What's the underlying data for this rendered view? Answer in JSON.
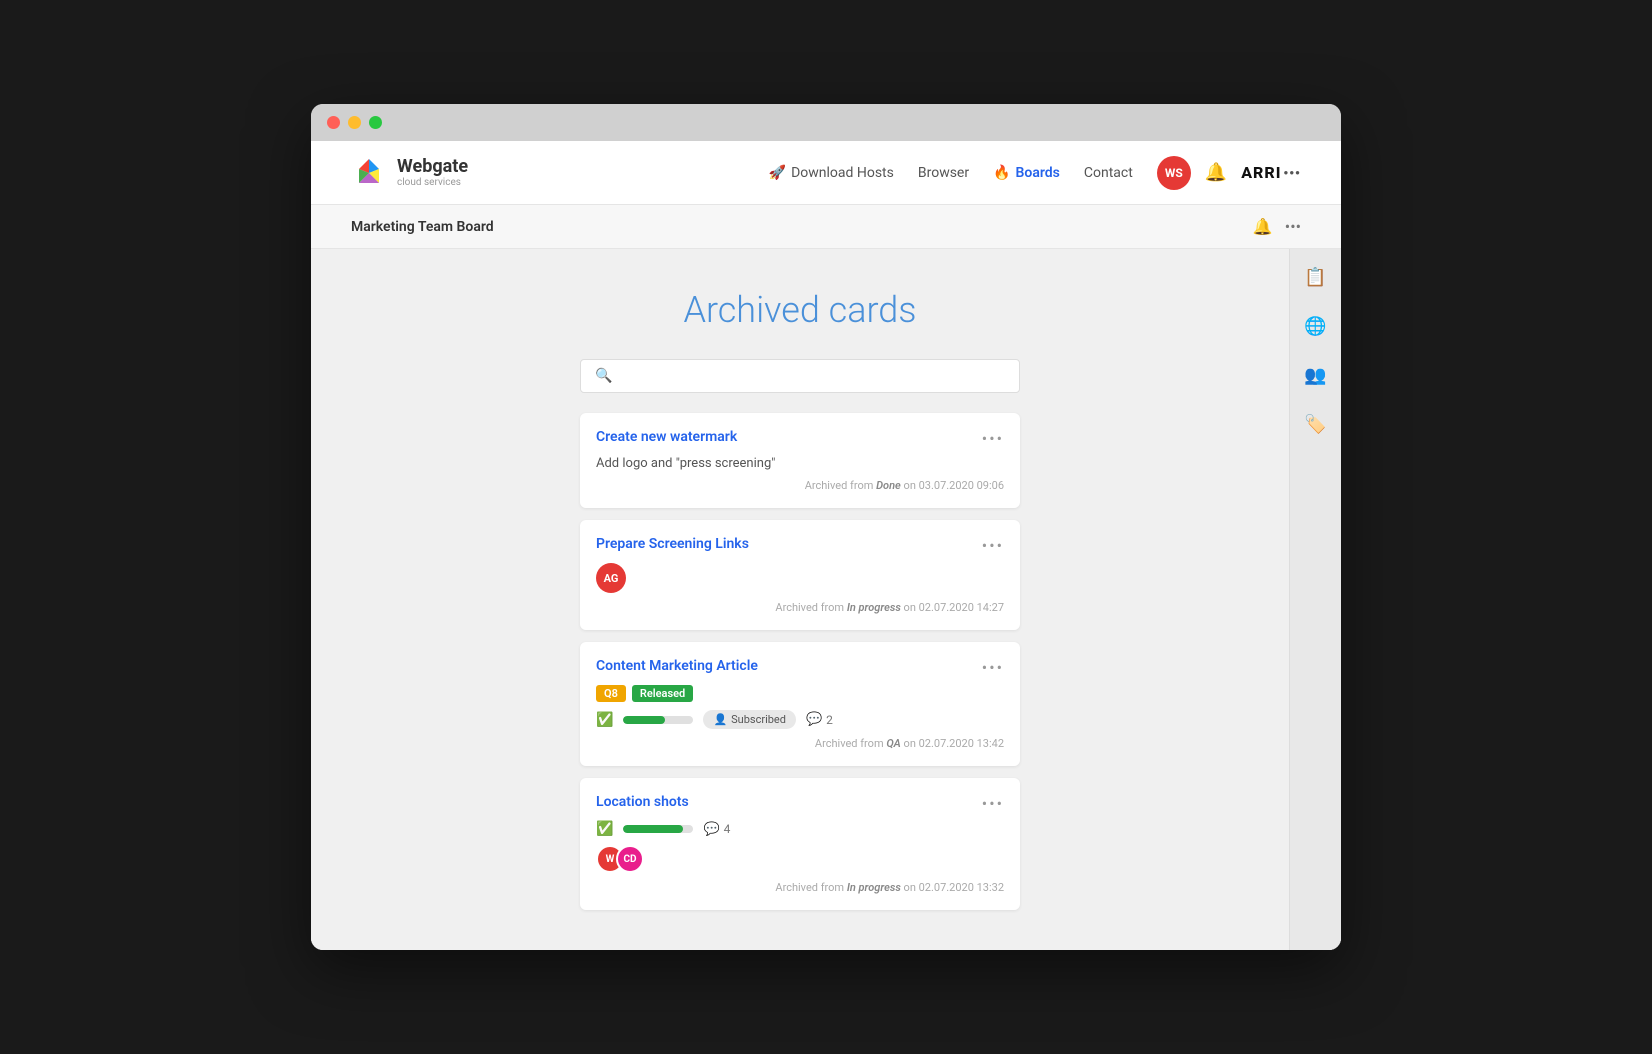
{
  "browser": {
    "dots": [
      "red",
      "yellow",
      "green"
    ]
  },
  "navbar": {
    "logo_name": "Webgate",
    "logo_sub": "cloud services",
    "nav_items": [
      {
        "label": "Download Hosts",
        "icon": "🚀",
        "active": false
      },
      {
        "label": "Browser",
        "icon": "",
        "active": false
      },
      {
        "label": "Boards",
        "icon": "🔥",
        "active": true
      },
      {
        "label": "Contact",
        "icon": "",
        "active": false
      }
    ],
    "avatar": "WS",
    "arri_label": "ARRI"
  },
  "subnav": {
    "title": "Marketing Team Board"
  },
  "page": {
    "title": "Archived cards",
    "search_placeholder": ""
  },
  "cards": [
    {
      "id": "card-1",
      "title": "Create new watermark",
      "description": "Add logo and \"press screening\"",
      "archived_from": "Done",
      "archived_date": "03.07.2020 09:06",
      "has_avatar": false,
      "tags": [],
      "progress": null,
      "subscribed": false,
      "comments": null
    },
    {
      "id": "card-2",
      "title": "Prepare Screening Links",
      "description": "",
      "archived_from": "In progress",
      "archived_date": "02.07.2020 14:27",
      "has_avatar": true,
      "avatar_text": "AG",
      "avatar_color": "#e53935",
      "tags": [],
      "progress": null,
      "subscribed": false,
      "comments": null
    },
    {
      "id": "card-3",
      "title": "Content Marketing Article",
      "description": "",
      "archived_from": "QA",
      "archived_date": "02.07.2020 13:42",
      "has_avatar": false,
      "tags": [
        {
          "label": "Q8",
          "class": "tag-q8"
        },
        {
          "label": "Released",
          "class": "tag-released"
        }
      ],
      "progress": 60,
      "subscribed": true,
      "subscribed_label": "Subscribed",
      "comments": 2
    },
    {
      "id": "card-4",
      "title": "Location shots",
      "description": "",
      "archived_from": "In progress",
      "archived_date": "02.07.2020 13:32",
      "has_avatar": false,
      "tags": [],
      "progress": 85,
      "subscribed": false,
      "comments": 4,
      "avatar_group": [
        {
          "text": "W",
          "class": "av-ws"
        },
        {
          "text": "CD",
          "class": "av-cd"
        }
      ]
    }
  ],
  "sidebar_icons": [
    "📋",
    "🌐",
    "👥",
    "🏷️"
  ]
}
